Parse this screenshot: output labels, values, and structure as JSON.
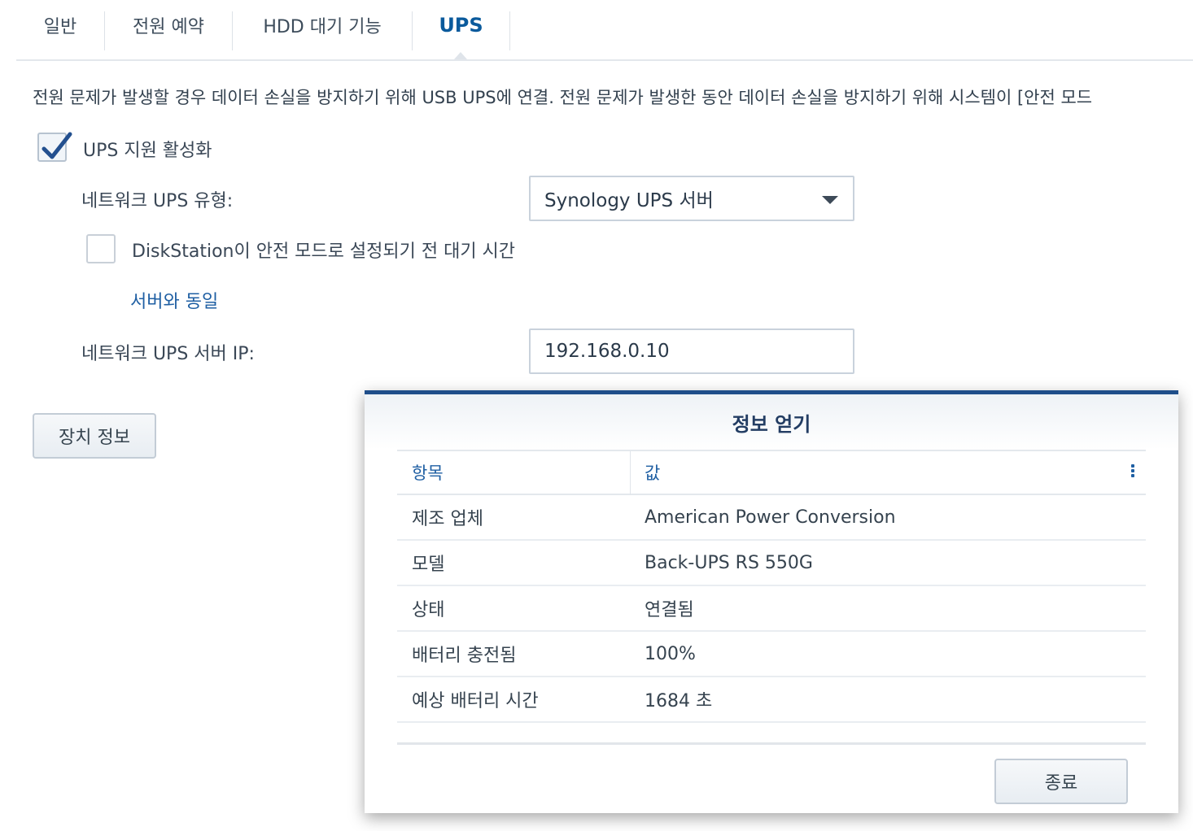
{
  "tabs": [
    {
      "label": "일반"
    },
    {
      "label": "전원 예약"
    },
    {
      "label": "HDD 대기 기능"
    },
    {
      "label": "UPS"
    }
  ],
  "description": "전원 문제가 발생할 경우 데이터 손실을 방지하기 위해 USB UPS에 연결. 전원 문제가 발생한 동안 데이터 손실을 방지하기 위해 시스템이 [안전 모드",
  "ups_enable": {
    "label": "UPS 지원 활성화",
    "checked": true
  },
  "network_ups_type": {
    "label": "네트워크 UPS 유형:",
    "value": "Synology UPS 서버"
  },
  "wait_time": {
    "label": "DiskStation이 안전 모드로 설정되기 전 대기 시간",
    "checked": false,
    "link": "서버와 동일"
  },
  "server_ip": {
    "label": "네트워크 UPS 서버 IP:",
    "value": "192.168.0.10"
  },
  "device_info_button": "장치 정보",
  "dialog": {
    "title": "정보 얻기",
    "columns": [
      "항목",
      "값"
    ],
    "rows": [
      {
        "item": "제조 업체",
        "value": "American Power Conversion"
      },
      {
        "item": "모델",
        "value": "Back-UPS RS 550G"
      },
      {
        "item": "상태",
        "value": "연결됨"
      },
      {
        "item": "배터리 충전됨",
        "value": "100%"
      },
      {
        "item": "예상 배터리 시간",
        "value": "1684 초"
      }
    ],
    "close_button": "종료"
  },
  "colors": {
    "accent": "#1f5fa3",
    "dialog_border": "#1f4e8a"
  }
}
